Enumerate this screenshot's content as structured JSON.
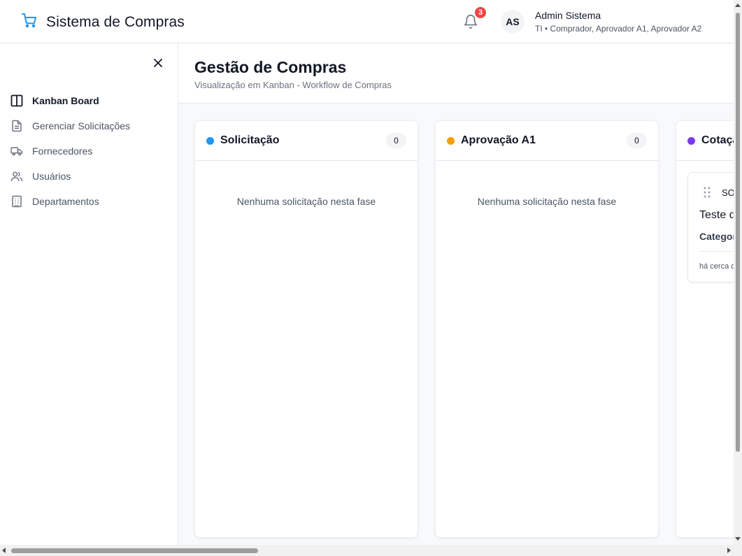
{
  "header": {
    "app_title": "Sistema de Compras",
    "notifications_count": "3",
    "user_initials": "AS",
    "user_name": "Admin Sistema",
    "user_role": "TI • Comprador, Aprovador A1, Aprovador A2",
    "brand_color": "#2196f3"
  },
  "sidebar": {
    "items": [
      {
        "label": "Kanban Board",
        "icon": "kanban-icon",
        "active": true
      },
      {
        "label": "Gerenciar Solicitações",
        "icon": "file-text-icon",
        "active": false
      },
      {
        "label": "Fornecedores",
        "icon": "truck-icon",
        "active": false
      },
      {
        "label": "Usuários",
        "icon": "users-icon",
        "active": false
      },
      {
        "label": "Departamentos",
        "icon": "building-icon",
        "active": false
      }
    ]
  },
  "page": {
    "title": "Gestão de Compras",
    "subtitle": "Visualização em Kanban - Workflow de Compras"
  },
  "columns": [
    {
      "title": "Solicitação",
      "count": "0",
      "color": "#2196f3",
      "empty_text": "Nenhuma solicitação nesta fase"
    },
    {
      "title": "Aprovação A1",
      "count": "0",
      "color": "#f59e0b",
      "empty_text": "Nenhuma solicitação nesta fase"
    },
    {
      "title": "Cotação",
      "count": "",
      "color": "#7c3aed"
    }
  ],
  "card": {
    "code": "SO",
    "title": "Teste d",
    "category": "Categor",
    "time": "há cerca d"
  }
}
